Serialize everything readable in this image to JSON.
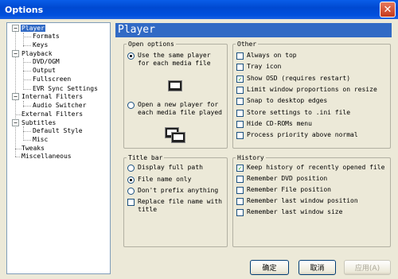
{
  "window": {
    "title": "Options",
    "close_glyph": "✕"
  },
  "tree": {
    "items": [
      {
        "label": "Player",
        "expander": "−",
        "selected": true
      },
      {
        "label": "Formats"
      },
      {
        "label": "Keys"
      },
      {
        "label": "Playback",
        "expander": "−"
      },
      {
        "label": "DVD/OGM"
      },
      {
        "label": "Output"
      },
      {
        "label": "Fullscreen"
      },
      {
        "label": "EVR Sync Settings"
      },
      {
        "label": "Internal Filters",
        "expander": "−"
      },
      {
        "label": "Audio Switcher"
      },
      {
        "label": "External Filters"
      },
      {
        "label": "Subtitles",
        "expander": "−"
      },
      {
        "label": "Default Style"
      },
      {
        "label": "Misc"
      },
      {
        "label": "Tweaks"
      },
      {
        "label": "Miscellaneous"
      }
    ]
  },
  "page": {
    "title": "Player"
  },
  "open_options": {
    "legend": "Open options",
    "same_player": "Use the same player for each media file",
    "new_player": "Open a new player for each media file played",
    "selected": "same_player"
  },
  "title_bar": {
    "legend": "Title bar",
    "display_full_path": "Display full path",
    "file_name_only": "File name only",
    "dont_prefix": "Don't prefix anything",
    "replace_with_title": "Replace file name with title",
    "selected": "file_name_only"
  },
  "other": {
    "legend": "Other",
    "items": [
      {
        "label": "Always on top",
        "checked": false
      },
      {
        "label": "Tray icon",
        "checked": false
      },
      {
        "label": "Show OSD (requires restart)",
        "checked": true
      },
      {
        "label": "Limit window proportions on resize",
        "checked": false
      },
      {
        "label": "Snap to desktop edges",
        "checked": false
      },
      {
        "label": "Store settings to .ini file",
        "checked": false
      },
      {
        "label": "Hide CD-ROMs menu",
        "checked": false
      },
      {
        "label": "Process priority above normal",
        "checked": false
      }
    ]
  },
  "history": {
    "legend": "History",
    "items": [
      {
        "label": "Keep history of recently opened file",
        "checked": true
      },
      {
        "label": "Remember DVD position",
        "checked": false
      },
      {
        "label": "Remember File position",
        "checked": false
      },
      {
        "label": "Remember last window position",
        "checked": false
      },
      {
        "label": "Remember last window size",
        "checked": false
      }
    ]
  },
  "buttons": {
    "ok": "确定",
    "cancel": "取消",
    "apply": "应用(A)"
  },
  "colors": {
    "accent": "#316ac5",
    "titlebar": "#0054e3",
    "check": "#21a121"
  }
}
